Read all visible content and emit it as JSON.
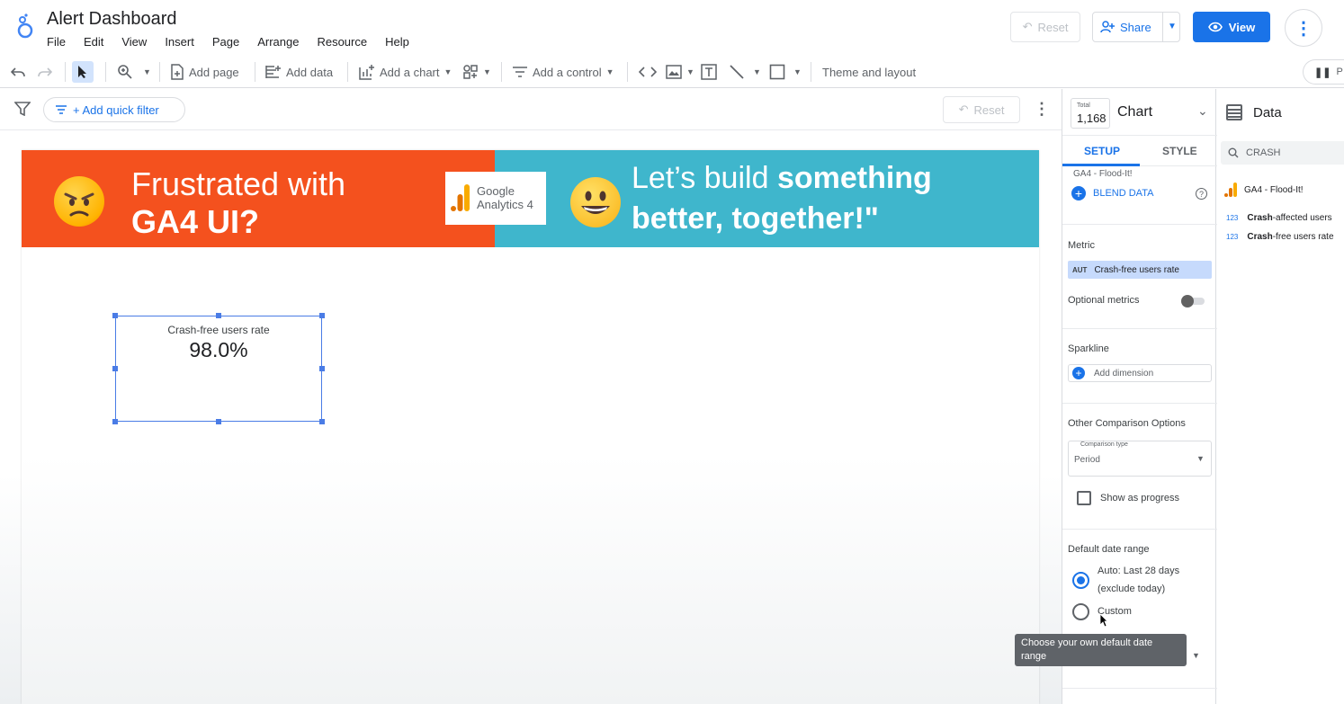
{
  "app": {
    "title": "Alert Dashboard",
    "menu": [
      "File",
      "Edit",
      "View",
      "Insert",
      "Page",
      "Arrange",
      "Resource",
      "Help"
    ],
    "reset_label": "Reset",
    "share_label": "Share",
    "view_label": "View"
  },
  "toolbar": {
    "add_page": "Add page",
    "add_data": "Add data",
    "add_chart": "Add a chart",
    "add_control": "Add a control",
    "theme_layout": "Theme and layout",
    "right_label": "P"
  },
  "filterbar": {
    "quick_filter": "+ Add quick filter",
    "reset_label": "Reset"
  },
  "banner": {
    "left_line1": "Frustrated with",
    "left_line2": "GA4 UI?",
    "ga_line1": "Google",
    "ga_line2": "Analytics 4",
    "right_line1_normal": "Let’s build ",
    "right_line1_bold": "something",
    "right_line2": "better, together!\""
  },
  "scorecard": {
    "label": "Crash-free users rate",
    "value": "98.0%"
  },
  "properties": {
    "total_label": "Total",
    "total_value": "1,168",
    "title": "Chart",
    "tab_setup": "SETUP",
    "tab_style": "STYLE",
    "data_source": "GA4 - Flood-It!",
    "blend_data": "BLEND DATA",
    "metric_label": "Metric",
    "metric_type": "AUT",
    "metric_value": "Crash-free users rate",
    "optional_metrics": "Optional metrics",
    "sparkline_label": "Sparkline",
    "add_dimension": "Add dimension",
    "other_comparison": "Other Comparison Options",
    "comparison_type_label": "Comparison type",
    "comparison_type_value": "Period",
    "show_as_progress": "Show as progress",
    "default_date_range": "Default date range",
    "auto_label": "Auto",
    "auto_detail": ": Last 28 days",
    "auto_detail2": "(exclude today)",
    "custom_label": "Custom"
  },
  "tooltip": {
    "text": "Choose your own default date range"
  },
  "data_panel": {
    "title": "Data",
    "search_value": "CRASH",
    "source": "GA4 - Flood-It!",
    "fields": [
      {
        "type": "123",
        "bold": "Crash",
        "rest": "-affected users"
      },
      {
        "type": "123",
        "bold": "Crash",
        "rest": "-free users rate"
      }
    ]
  },
  "colors": {
    "accent": "#1a73e8",
    "banner_left": "#f4511e",
    "banner_right": "#3fb6cc"
  }
}
